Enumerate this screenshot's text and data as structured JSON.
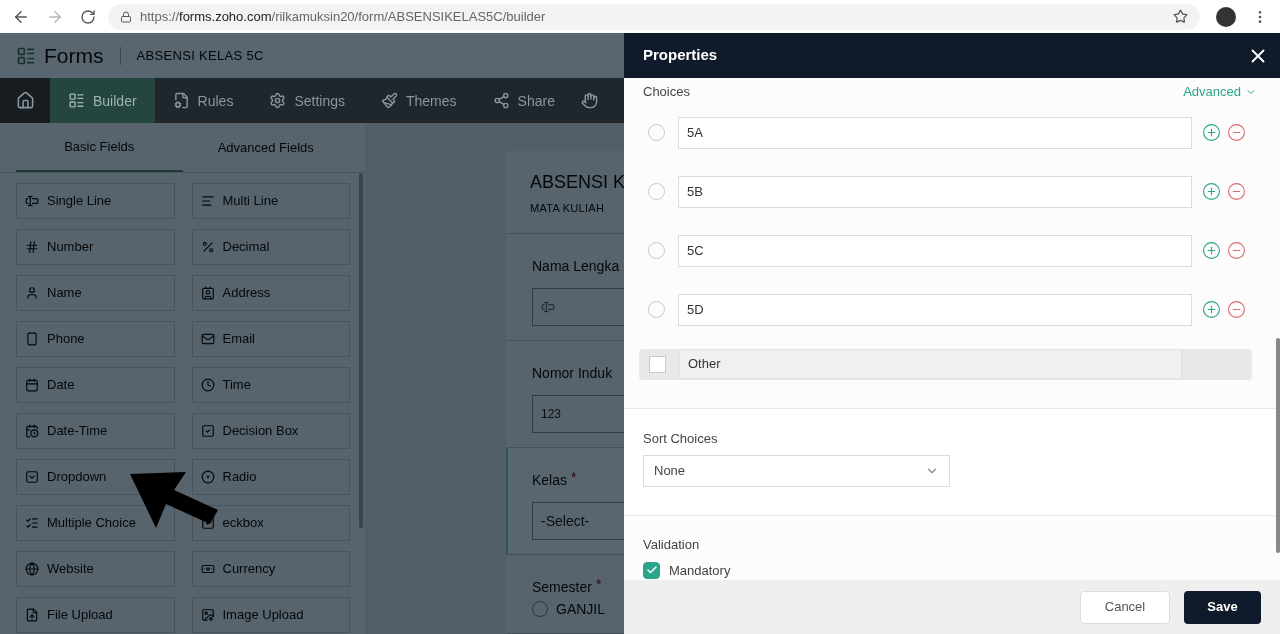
{
  "browser": {
    "url": "https://**forms.zoho.com**/rilkamuksin20/form/ABSENSIKELAS5C/builder"
  },
  "app": {
    "logo": "Forms",
    "form_name": "ABSENSI KELAS 5C"
  },
  "nav": [
    {
      "label": "Builder",
      "selected": true
    },
    {
      "label": "Rules",
      "selected": false
    },
    {
      "label": "Settings",
      "selected": false
    },
    {
      "label": "Themes",
      "selected": false
    },
    {
      "label": "Share",
      "selected": false
    }
  ],
  "field_tabs": [
    {
      "label": "Basic Fields",
      "selected": true
    },
    {
      "label": "Advanced Fields",
      "selected": false
    }
  ],
  "fields": [
    {
      "label": "Single Line"
    },
    {
      "label": "Multi Line"
    },
    {
      "label": "Number"
    },
    {
      "label": "Decimal"
    },
    {
      "label": "Name"
    },
    {
      "label": "Address"
    },
    {
      "label": "Phone"
    },
    {
      "label": "Email"
    },
    {
      "label": "Date"
    },
    {
      "label": "Time"
    },
    {
      "label": "Date-Time"
    },
    {
      "label": "Decision Box"
    },
    {
      "label": "Dropdown"
    },
    {
      "label": "Radio"
    },
    {
      "label": "Multiple Choice"
    },
    {
      "label": "eckbox"
    },
    {
      "label": "Website"
    },
    {
      "label": "Currency"
    },
    {
      "label": "File Upload"
    },
    {
      "label": "Image Upload"
    }
  ],
  "canvas": {
    "title": "ABSENSI K",
    "subtitle": "MATA KULIAH",
    "questions": [
      {
        "kind": "text",
        "label": "Nama Lengka",
        "selected": false
      },
      {
        "kind": "number",
        "label": "Nomor Induk",
        "selected": false,
        "placeholder": "123"
      },
      {
        "kind": "select",
        "label": "Kelas",
        "required_mark": "*",
        "selected": true,
        "placeholder": "-Select-"
      },
      {
        "kind": "radio",
        "label": "Semester",
        "required_mark": "*",
        "selected": false,
        "option": "GANJIL"
      }
    ]
  },
  "properties": {
    "title": "Properties",
    "choices_label": "Choices",
    "advanced": "Advanced",
    "choices": [
      {
        "value": "5A",
        "selected": false
      },
      {
        "value": "5B",
        "selected": false
      },
      {
        "value": "5C",
        "selected": false
      },
      {
        "value": "5D",
        "selected": false
      }
    ],
    "other": {
      "label": "Other",
      "checked": false
    },
    "sort": {
      "label": "Sort Choices",
      "value": "None"
    },
    "validation": {
      "label": "Validation",
      "mandatory": {
        "label": "Mandatory",
        "checked": true
      }
    },
    "buttons": {
      "cancel": "Cancel",
      "save": "Save"
    }
  }
}
